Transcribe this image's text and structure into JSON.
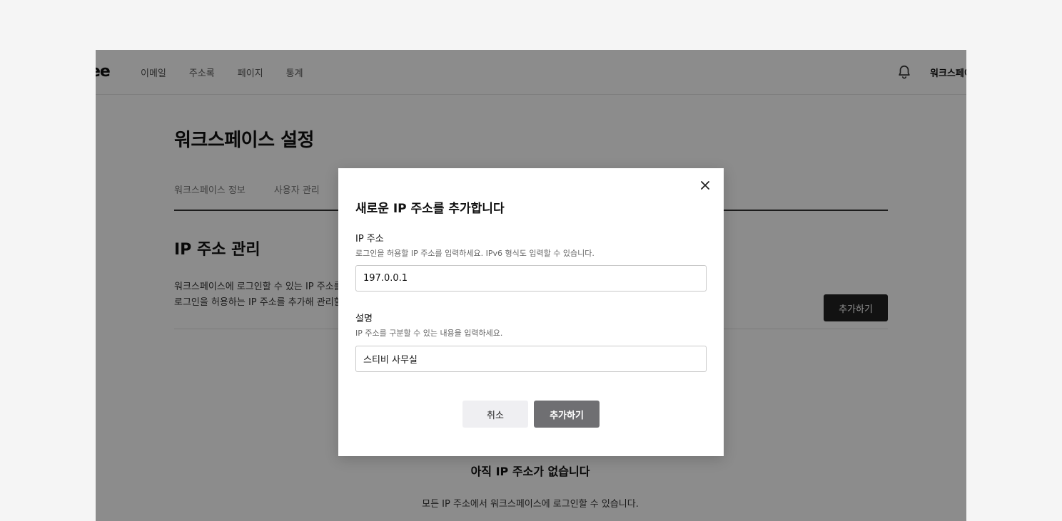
{
  "app": {
    "logo_text": "ee",
    "nav": [
      "이메일",
      "주소록",
      "페이지",
      "통계"
    ],
    "workspace_name": "워크스페이"
  },
  "page": {
    "title": "워크스페이스 설정",
    "tabs": [
      "워크스페이스 정보",
      "사용자 관리"
    ],
    "section_title": "IP 주소 관리",
    "section_desc_line1": "워크스페이스에 로그인할 수 있는 IP 주소를",
    "section_desc_line2": "로그인을 허용하는 IP 주소를 추가해 관리할",
    "add_button": "추가하기",
    "empty_title": "아직 IP 주소가 없습니다",
    "empty_desc": "모든 IP 주소에서 워크스페이스에 로그인할 수 있습니다."
  },
  "modal": {
    "title": "새로운 IP 주소를 추가합니다",
    "ip_label": "IP 주소",
    "ip_help": "로그인을 허용할 IP 주소를 입력하세요. IPv6 형식도 입력할 수 있습니다.",
    "ip_value": "197.0.0.1",
    "desc_label": "설명",
    "desc_help": "IP 주소를 구분할 수 있는 내용을 입력하세요.",
    "desc_value": "스티비 사무실",
    "cancel_label": "취소",
    "submit_label": "추가하기"
  },
  "icons": {
    "bell": "bell-icon",
    "close": "close-icon"
  },
  "colors": {
    "overlay": "#000000",
    "primary_button": "#222222",
    "modal_submit": "#6f6f72",
    "modal_cancel": "#efeff2"
  }
}
